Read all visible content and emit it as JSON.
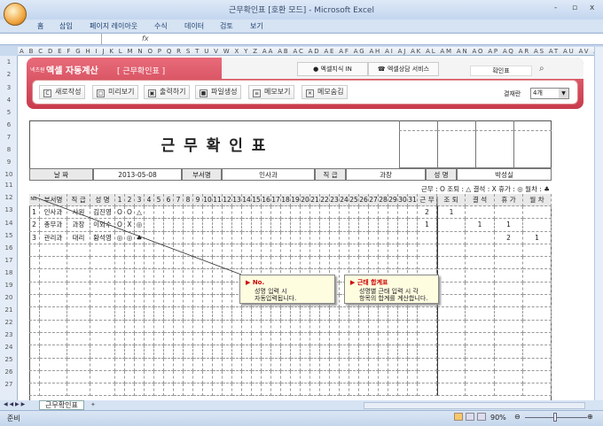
{
  "window": {
    "title": "근무확인표  [호환 모드] - Microsoft Excel",
    "minimize": "-",
    "restore": "▫",
    "close": "x"
  },
  "ribbon_tabs": [
    "홈",
    "삽입",
    "페이지 레이아웃",
    "수식",
    "데이터",
    "검토",
    "보기"
  ],
  "formula_bar": {
    "fx": "fx",
    "value": ""
  },
  "column_headers": "A B C D E F G H I J K L M N O P Q R S T U V W X Y Z AA AB AC AD AE AF AG AH AI AJ AK AL AM AN AO AP AQ AR AS AT AU AV AW AX AY AZ BB BC BD",
  "banner": {
    "brand_small": "넥츠원",
    "brand": "엑셀 자동계산",
    "subtitle": "[ 근무확인표 ]",
    "tab1": "엑셀지식 IN",
    "tab2": "엑셀상담 서비스",
    "search_value": "확인표",
    "buttons": [
      "새로작성",
      "미리보기",
      "출력하기",
      "파일생성",
      "메모보기",
      "메모숨김"
    ],
    "approval_label": "결재란",
    "approval_value": "4개"
  },
  "form": {
    "title": "근 무 확 인 표",
    "date_label": "날 짜",
    "date": "2013-05-08",
    "dept_label": "부서명",
    "dept": "인사과",
    "rank_label": "직 급",
    "rank": "과장",
    "name_label": "성 명",
    "name": "박성실",
    "legend": "근무 : O   조퇴 : △   결석 : X   휴가 : ◎   월차 : ♣",
    "headers": {
      "no": "No.",
      "dept": "부서명",
      "rank": "직 급",
      "name": "성 명",
      "days": [
        "1",
        "2",
        "3",
        "4",
        "5",
        "6",
        "7",
        "8",
        "9",
        "10",
        "11",
        "12",
        "13",
        "14",
        "15",
        "16",
        "17",
        "18",
        "19",
        "20",
        "21",
        "22",
        "23",
        "24",
        "25",
        "26",
        "27",
        "28",
        "29",
        "30",
        "31"
      ],
      "totals": [
        "근 무",
        "조 퇴",
        "결 석",
        "휴 가",
        "월 차"
      ]
    },
    "rows": [
      {
        "no": "1",
        "dept": "인사과",
        "rank": "사원",
        "name": "김진영",
        "days": [
          "O",
          "O",
          "△"
        ],
        "totals": [
          "2",
          "1",
          "",
          "",
          ""
        ]
      },
      {
        "no": "2",
        "dept": "총무과",
        "rank": "과장",
        "name": "이외수",
        "days": [
          "O",
          "X",
          "◎"
        ],
        "totals": [
          "1",
          "",
          "1",
          "1",
          ""
        ]
      },
      {
        "no": "3",
        "dept": "관리과",
        "rank": "대리",
        "name": "황석영",
        "days": [
          "◎",
          "◎",
          "♣"
        ],
        "totals": [
          "",
          "",
          "",
          "2",
          "1"
        ]
      }
    ]
  },
  "callouts": [
    {
      "title": "No.",
      "line1": "성명 입력 시",
      "line2": "자동입력됩니다."
    },
    {
      "title": "근태 합계표",
      "line1": "성명별 근태 입력 시 각",
      "line2": "항목의 합계를 계산합니다."
    }
  ],
  "sheet_tab": "근무확인표",
  "status": {
    "ready": "준비",
    "zoom": "90%"
  }
}
